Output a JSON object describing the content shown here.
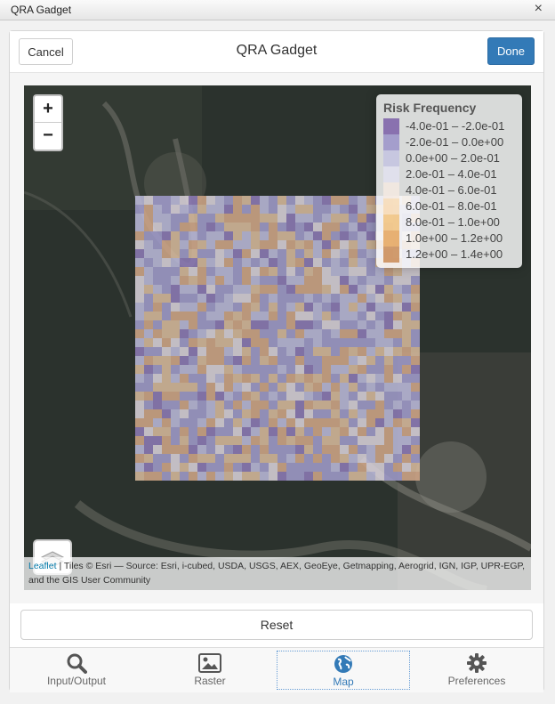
{
  "window": {
    "title": "QRA Gadget",
    "close_glyph": "×"
  },
  "header": {
    "cancel_label": "Cancel",
    "title": "QRA Gadget",
    "done_label": "Done"
  },
  "map": {
    "zoom_in": "+",
    "zoom_out": "−",
    "legend": {
      "title": "Risk Frequency",
      "items": [
        {
          "label": "-4.0e-01 – -2.0e-01",
          "color": "#7b5ea7"
        },
        {
          "label": "-2.0e-01 – 0.0e+00",
          "color": "#9b93c9"
        },
        {
          "label": "0.0e+00 – 2.0e-01",
          "color": "#c4c3e0"
        },
        {
          "label": "2.0e-01 – 4.0e-01",
          "color": "#e2e0ef"
        },
        {
          "label": "4.0e-01 – 6.0e-01",
          "color": "#f4e9e0"
        },
        {
          "label": "6.0e-01 – 8.0e-01",
          "color": "#f7dbb5"
        },
        {
          "label": "8.0e-01 – 1.0e+00",
          "color": "#f1c27d"
        },
        {
          "label": "1.0e+00 – 1.2e+00",
          "color": "#e5a45c"
        },
        {
          "label": "1.2e+00 – 1.4e+00",
          "color": "#c98b55"
        }
      ]
    },
    "attribution": {
      "leaflet": "Leaflet",
      "text": " | Tiles © Esri — Source: Esri, i-cubed, USDA, USGS, AEX, GeoEye, Getmapping, Aerogrid, IGN, IGP, UPR-EGP, and the GIS User Community"
    },
    "layers_icon": "layers-icon"
  },
  "reset_label": "Reset",
  "tabs": [
    {
      "label": "Input/Output",
      "icon": "search-icon",
      "active": false
    },
    {
      "label": "Raster",
      "icon": "image-icon",
      "active": false
    },
    {
      "label": "Map",
      "icon": "globe-icon",
      "active": true
    },
    {
      "label": "Preferences",
      "icon": "gear-icon",
      "active": false
    }
  ],
  "colors": {
    "accent": "#337ab7",
    "low_risk": "#9b93c9",
    "high_risk": "#e5a45c"
  }
}
